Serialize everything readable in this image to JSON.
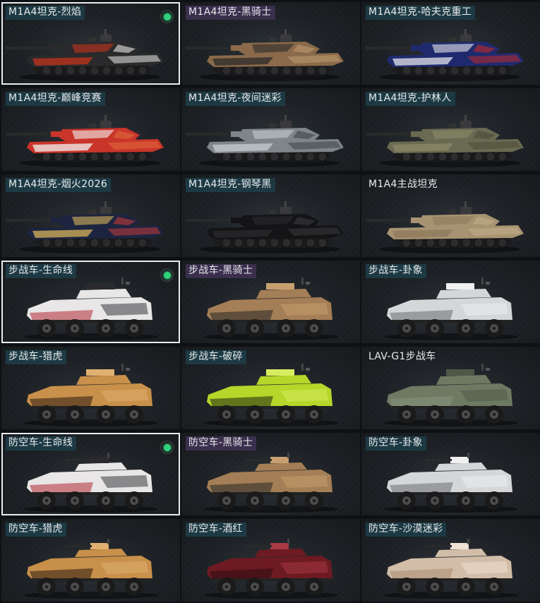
{
  "items": [
    {
      "label": "M1A4坦克-烈焰",
      "tag": "tag-teal",
      "selected": true,
      "equipped": true,
      "kind": "tank",
      "body": "#2a2a2c",
      "accent": "#c4341c",
      "accent2": "#e8e8e8"
    },
    {
      "label": "M1A4坦克-黑骑士",
      "tag": "tag-purple",
      "selected": false,
      "equipped": false,
      "kind": "tank",
      "body": "#8a6a4a",
      "accent": "#2b2b2b",
      "accent2": "#c09a70"
    },
    {
      "label": "M1A4坦克-哈夫克重工",
      "tag": "tag-teal",
      "selected": false,
      "equipped": false,
      "kind": "tank",
      "body": "#1f2a6e",
      "accent": "#e6e6ea",
      "accent2": "#c02a2a"
    },
    {
      "label": "M1A4坦克-巅峰竞赛",
      "tag": "tag-teal",
      "selected": false,
      "equipped": false,
      "kind": "tank",
      "body": "#c9352a",
      "accent": "#f2f2f2",
      "accent2": "#e06a3a"
    },
    {
      "label": "M1A4坦克-夜间迷彩",
      "tag": "tag-teal",
      "selected": false,
      "equipped": false,
      "kind": "tank",
      "body": "#7e868c",
      "accent": "#c8ccd0",
      "accent2": "#3c4246"
    },
    {
      "label": "M1A4坦克-护林人",
      "tag": "tag-teal",
      "selected": false,
      "equipped": false,
      "kind": "tank",
      "body": "#6a6a52",
      "accent": "#8d8a6a",
      "accent2": "#4a4a38"
    },
    {
      "label": "M1A4坦克-烟火2026",
      "tag": "tag-teal",
      "selected": false,
      "equipped": false,
      "kind": "tank",
      "body": "#1d2440",
      "accent": "#d6b25a",
      "accent2": "#c23a3a"
    },
    {
      "label": "M1A4坦克-钢琴黑",
      "tag": "tag-teal",
      "selected": false,
      "equipped": false,
      "kind": "tank",
      "body": "#141416",
      "accent": "#2a2a2e",
      "accent2": "#3a3a3e"
    },
    {
      "label": "M1A4主战坦克",
      "tag": "tag-none",
      "selected": false,
      "equipped": false,
      "kind": "tank",
      "body": "#a79372",
      "accent": "#8e7a5c",
      "accent2": "#c2ae88"
    },
    {
      "label": "步战车-生命线",
      "tag": "tag-teal",
      "selected": true,
      "equipped": true,
      "kind": "ifv",
      "body": "#e8e6e6",
      "accent": "#b02a34",
      "accent2": "#2a2a2e"
    },
    {
      "label": "步战车-黑骑士",
      "tag": "tag-purple",
      "selected": false,
      "equipped": false,
      "kind": "ifv",
      "body": "#a47e56",
      "accent": "#262626",
      "accent2": "#c8a070"
    },
    {
      "label": "步战车-卦象",
      "tag": "tag-teal",
      "selected": false,
      "equipped": false,
      "kind": "ifv",
      "body": "#d4d6d8",
      "accent": "#6a6e72",
      "accent2": "#f0f0f0"
    },
    {
      "label": "步战车-猎虎",
      "tag": "tag-teal",
      "selected": false,
      "equipped": false,
      "kind": "ifv",
      "body": "#c8904a",
      "accent": "#2a1a10",
      "accent2": "#e0b070"
    },
    {
      "label": "步战车-破碎",
      "tag": "tag-teal",
      "selected": false,
      "equipped": false,
      "kind": "ifv",
      "body": "#b6d62a",
      "accent": "#1e2410",
      "accent2": "#d8ec60"
    },
    {
      "label": "LAV-G1步战车",
      "tag": "tag-none",
      "selected": false,
      "equipped": false,
      "kind": "ifv",
      "body": "#6e7a62",
      "accent": "#8a9480",
      "accent2": "#4e5848"
    },
    {
      "label": "防空车-生命线",
      "tag": "tag-teal",
      "selected": true,
      "equipped": true,
      "kind": "aa",
      "body": "#e8e6e6",
      "accent": "#b02a34",
      "accent2": "#2a2a2e"
    },
    {
      "label": "防空车-黑骑士",
      "tag": "tag-purple",
      "selected": false,
      "equipped": false,
      "kind": "aa",
      "body": "#a47e56",
      "accent": "#262626",
      "accent2": "#c8a070"
    },
    {
      "label": "防空车-卦象",
      "tag": "tag-teal",
      "selected": false,
      "equipped": false,
      "kind": "aa",
      "body": "#d4d6d8",
      "accent": "#6a6e72",
      "accent2": "#f0f0f0"
    },
    {
      "label": "防空车-猎虎",
      "tag": "tag-teal",
      "selected": false,
      "equipped": false,
      "kind": "aa",
      "body": "#c8904a",
      "accent": "#2a1a10",
      "accent2": "#e0b070"
    },
    {
      "label": "防空车-酒红",
      "tag": "tag-teal",
      "selected": false,
      "equipped": false,
      "kind": "aa",
      "body": "#6e1a22",
      "accent": "#2a0c10",
      "accent2": "#a83a44"
    },
    {
      "label": "防空车-沙漠迷彩",
      "tag": "tag-teal",
      "selected": false,
      "equipped": false,
      "kind": "aa",
      "body": "#d2bea8",
      "accent": "#a88a70",
      "accent2": "#efe2d4"
    }
  ]
}
